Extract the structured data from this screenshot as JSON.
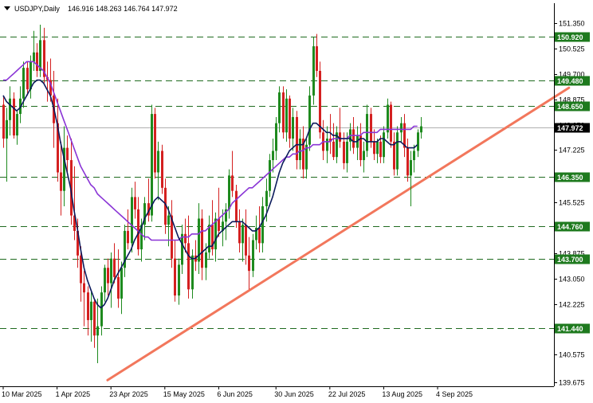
{
  "header": {
    "symbol": "USDJPY,Daily",
    "ohlc": "146.916 148.263 146.764 147.972"
  },
  "colors": {
    "background": "#ffffff",
    "bull_candle": "#1e8a1e",
    "bear_candle": "#d42020",
    "ma_fast": "#0b1a5c",
    "ma_slow": "#8a35d6",
    "trendline": "#f2775c",
    "level_badge": "#1e7a1e",
    "level_line": "#1f6b1f",
    "price_badge": "#000000",
    "axis": "#000000"
  },
  "chart_data": {
    "type": "candlestick",
    "title": "USDJPY,Daily",
    "ylim": [
      139.55,
      152.0
    ],
    "y_ticks": [
      "151.350",
      "150.525",
      "149.700",
      "148.875",
      "148.050",
      "147.225",
      "146.400",
      "145.525",
      "144.700",
      "143.875",
      "143.050",
      "142.225",
      "141.400",
      "140.575",
      "139.675"
    ],
    "x_labels": [
      "10 Mar 2025",
      "1 Apr 2025",
      "23 Apr 2025",
      "15 May 2025",
      "6 Jun 2025",
      "30 Jun 2025",
      "22 Jul 2025",
      "13 Aug 2025",
      "4 Sep 2025"
    ],
    "x_label_index": [
      0,
      16,
      32,
      48,
      64,
      81,
      97,
      113,
      129
    ],
    "current_price": "147.972",
    "levels": [
      {
        "label": "150.920",
        "value": 150.92
      },
      {
        "label": "149.480",
        "value": 149.48
      },
      {
        "label": "148.650",
        "value": 148.65
      },
      {
        "label": "146.350",
        "value": 146.35
      },
      {
        "label": "144.760",
        "value": 144.76
      },
      {
        "label": "143.700",
        "value": 143.7
      },
      {
        "label": "141.440",
        "value": 141.44
      }
    ],
    "trendline": {
      "start": {
        "index": 31,
        "price": 139.75
      },
      "end": {
        "index": 168,
        "price": 149.25
      }
    },
    "candles": [
      [
        148.7,
        149.0,
        147.3,
        147.6
      ],
      [
        147.6,
        148.6,
        146.2,
        148.2
      ],
      [
        148.2,
        149.3,
        147.7,
        148.9
      ],
      [
        148.9,
        149.1,
        147.6,
        147.7
      ],
      [
        147.7,
        148.5,
        147.4,
        148.4
      ],
      [
        148.4,
        149.3,
        148.1,
        148.9
      ],
      [
        148.9,
        150.1,
        148.6,
        149.9
      ],
      [
        149.9,
        150.1,
        149.0,
        149.2
      ],
      [
        149.2,
        150.3,
        148.9,
        150.1
      ],
      [
        150.1,
        151.1,
        149.8,
        150.4
      ],
      [
        150.4,
        150.7,
        149.6,
        149.8
      ],
      [
        149.8,
        151.3,
        149.6,
        150.8
      ],
      [
        150.8,
        151.2,
        149.4,
        149.6
      ],
      [
        149.6,
        150.1,
        148.8,
        149.5
      ],
      [
        149.5,
        150.2,
        148.8,
        149.0
      ],
      [
        149.0,
        149.8,
        147.3,
        148.1
      ],
      [
        148.1,
        148.9,
        146.2,
        146.5
      ],
      [
        146.5,
        147.5,
        145.1,
        145.9
      ],
      [
        145.9,
        148.0,
        145.4,
        147.3
      ],
      [
        147.3,
        147.7,
        146.5,
        146.9
      ],
      [
        146.9,
        147.6,
        144.8,
        145.1
      ],
      [
        145.1,
        146.7,
        144.3,
        144.6
      ],
      [
        144.6,
        145.0,
        143.4,
        143.8
      ],
      [
        143.8,
        144.1,
        142.3,
        142.9
      ],
      [
        142.9,
        143.3,
        141.5,
        142.6
      ],
      [
        142.6,
        142.8,
        141.2,
        141.7
      ],
      [
        141.7,
        142.6,
        141.0,
        142.3
      ],
      [
        142.3,
        142.4,
        140.8,
        141.2
      ],
      [
        141.2,
        142.4,
        140.3,
        141.5
      ],
      [
        141.5,
        142.8,
        141.2,
        142.6
      ],
      [
        142.6,
        143.5,
        142.3,
        143.4
      ],
      [
        143.4,
        143.7,
        142.5,
        142.9
      ],
      [
        142.9,
        143.9,
        142.1,
        143.7
      ],
      [
        143.7,
        144.2,
        142.9,
        143.1
      ],
      [
        143.1,
        144.0,
        142.1,
        142.4
      ],
      [
        142.4,
        143.6,
        141.9,
        143.4
      ],
      [
        143.4,
        144.8,
        143.1,
        144.6
      ],
      [
        144.6,
        145.3,
        144.0,
        144.2
      ],
      [
        144.2,
        146.0,
        143.9,
        145.7
      ],
      [
        145.7,
        146.2,
        145.0,
        145.3
      ],
      [
        145.3,
        145.7,
        143.8,
        144.0
      ],
      [
        144.0,
        145.0,
        143.6,
        144.8
      ],
      [
        144.8,
        145.7,
        144.3,
        145.5
      ],
      [
        145.5,
        146.3,
        144.9,
        145.1
      ],
      [
        145.1,
        148.7,
        144.9,
        148.4
      ],
      [
        148.4,
        148.6,
        146.3,
        146.5
      ],
      [
        146.5,
        147.5,
        145.6,
        147.2
      ],
      [
        147.2,
        147.4,
        145.8,
        146.0
      ],
      [
        146.0,
        146.3,
        144.5,
        144.8
      ],
      [
        144.8,
        145.4,
        144.1,
        145.1
      ],
      [
        145.1,
        145.6,
        143.4,
        143.7
      ],
      [
        143.7,
        144.3,
        142.3,
        142.5
      ],
      [
        142.5,
        143.7,
        142.2,
        143.5
      ],
      [
        143.5,
        144.8,
        143.2,
        144.5
      ],
      [
        144.5,
        145.0,
        143.9,
        144.2
      ],
      [
        144.2,
        145.1,
        142.4,
        142.7
      ],
      [
        142.7,
        144.0,
        142.4,
        143.8
      ],
      [
        143.8,
        144.3,
        143.3,
        143.6
      ],
      [
        143.6,
        145.5,
        143.2,
        145.0
      ],
      [
        145.0,
        145.3,
        143.0,
        143.4
      ],
      [
        143.4,
        144.2,
        143.0,
        143.9
      ],
      [
        143.9,
        145.1,
        143.7,
        144.8
      ],
      [
        144.8,
        145.6,
        143.8,
        144.0
      ],
      [
        144.0,
        145.2,
        143.6,
        145.0
      ],
      [
        145.0,
        146.0,
        144.4,
        144.6
      ],
      [
        144.6,
        145.3,
        144.1,
        144.9
      ],
      [
        144.9,
        145.5,
        144.3,
        145.3
      ],
      [
        145.3,
        146.6,
        145.0,
        146.4
      ],
      [
        146.4,
        147.2,
        145.7,
        145.9
      ],
      [
        145.9,
        146.1,
        144.7,
        144.9
      ],
      [
        144.9,
        145.3,
        143.9,
        144.2
      ],
      [
        144.2,
        145.0,
        143.6,
        144.8
      ],
      [
        144.8,
        145.3,
        143.5,
        143.8
      ],
      [
        143.8,
        144.4,
        142.7,
        143.3
      ],
      [
        143.3,
        144.5,
        143.1,
        144.3
      ],
      [
        144.3,
        145.1,
        144.0,
        144.7
      ],
      [
        144.7,
        145.4,
        143.9,
        144.2
      ],
      [
        144.2,
        145.7,
        143.9,
        145.4
      ],
      [
        145.4,
        146.3,
        144.9,
        145.9
      ],
      [
        145.9,
        147.1,
        145.7,
        146.9
      ],
      [
        146.9,
        147.6,
        146.5,
        147.2
      ],
      [
        147.2,
        148.3,
        146.9,
        148.1
      ],
      [
        148.1,
        149.3,
        147.8,
        149.1
      ],
      [
        149.1,
        149.3,
        147.6,
        147.8
      ],
      [
        147.8,
        149.2,
        147.5,
        148.9
      ],
      [
        148.9,
        149.0,
        147.3,
        147.6
      ],
      [
        147.6,
        148.6,
        147.2,
        148.3
      ],
      [
        148.3,
        148.5,
        146.6,
        146.9
      ],
      [
        146.9,
        147.9,
        146.6,
        147.6
      ],
      [
        147.6,
        148.0,
        146.3,
        146.6
      ],
      [
        146.6,
        147.6,
        146.3,
        147.4
      ],
      [
        147.4,
        149.3,
        147.2,
        149.0
      ],
      [
        149.0,
        150.9,
        148.7,
        150.6
      ],
      [
        150.6,
        151.0,
        149.6,
        149.8
      ],
      [
        149.8,
        150.1,
        147.6,
        147.8
      ],
      [
        147.8,
        148.2,
        146.9,
        147.2
      ],
      [
        147.2,
        148.0,
        146.8,
        147.6
      ],
      [
        147.6,
        148.4,
        147.1,
        147.5
      ],
      [
        147.5,
        148.1,
        146.9,
        147.0
      ],
      [
        147.0,
        148.0,
        146.8,
        147.8
      ],
      [
        147.8,
        148.6,
        147.3,
        147.5
      ],
      [
        147.5,
        147.8,
        146.6,
        146.8
      ],
      [
        146.8,
        147.8,
        146.5,
        147.5
      ],
      [
        147.5,
        148.1,
        147.2,
        147.9
      ],
      [
        147.9,
        148.3,
        147.1,
        147.3
      ],
      [
        147.3,
        148.0,
        146.9,
        147.7
      ],
      [
        147.7,
        148.1,
        146.7,
        146.9
      ],
      [
        146.9,
        147.5,
        146.5,
        147.2
      ],
      [
        147.2,
        148.7,
        147.0,
        148.4
      ],
      [
        148.4,
        148.6,
        147.3,
        147.5
      ],
      [
        147.5,
        147.9,
        146.9,
        147.1
      ],
      [
        147.1,
        147.6,
        146.8,
        147.5
      ],
      [
        147.5,
        147.7,
        146.8,
        147.0
      ],
      [
        147.0,
        148.0,
        146.8,
        147.8
      ],
      [
        147.8,
        148.9,
        147.6,
        148.7
      ],
      [
        148.7,
        148.8,
        147.3,
        147.5
      ],
      [
        147.5,
        147.8,
        146.4,
        146.6
      ],
      [
        146.6,
        148.0,
        146.4,
        147.8
      ],
      [
        147.8,
        148.3,
        147.5,
        148.1
      ],
      [
        148.1,
        148.4,
        147.0,
        147.3
      ],
      [
        147.3,
        147.6,
        146.2,
        146.4
      ],
      [
        146.4,
        147.2,
        145.4,
        146.9
      ],
      [
        146.9,
        147.4,
        146.5,
        147.2
      ],
      [
        147.2,
        147.9,
        147.0,
        147.8
      ],
      [
        147.8,
        148.3,
        147.6,
        148.0
      ]
    ],
    "ma_fast": {
      "start_index": 0,
      "values": [
        149.0,
        148.8,
        148.7,
        148.6,
        148.5,
        148.6,
        148.8,
        149.0,
        149.2,
        149.4,
        149.5,
        149.5,
        149.4,
        149.2,
        149.0,
        148.6,
        148.1,
        147.5,
        147.0,
        146.5,
        146.0,
        145.3,
        144.7,
        144.0,
        143.4,
        143.0,
        142.7,
        142.4,
        142.2,
        142.1,
        142.2,
        142.4,
        142.7,
        143.0,
        143.2,
        143.4,
        143.6,
        143.8,
        144.0,
        144.3,
        144.5,
        144.7,
        145.0,
        145.2,
        145.4,
        145.6,
        145.7,
        145.6,
        145.5,
        145.3,
        145.0,
        144.7,
        144.4,
        144.2,
        144.0,
        143.8,
        143.7,
        143.7,
        143.8,
        143.9,
        144.0,
        144.1,
        144.1,
        144.3,
        144.5,
        144.6,
        144.7,
        144.8,
        144.9,
        144.9,
        144.9,
        144.9,
        144.8,
        144.7,
        144.6,
        144.6,
        144.7,
        144.9,
        145.1,
        145.4,
        145.7,
        146.1,
        146.5,
        146.8,
        147.0,
        147.2,
        147.3,
        147.4,
        147.4,
        147.4,
        147.6,
        147.9,
        148.1,
        148.1,
        148.0,
        147.9,
        147.8,
        147.8,
        147.7,
        147.7,
        147.6,
        147.6,
        147.6,
        147.6,
        147.5,
        147.5,
        147.6,
        147.6,
        147.5,
        147.5,
        147.5,
        147.5,
        147.6,
        147.6,
        147.5,
        147.4,
        147.4,
        147.5,
        147.5,
        147.4,
        147.3,
        147.3,
        147.3,
        147.4
      ]
    },
    "ma_slow": {
      "start_index": 0,
      "values": [
        149.5,
        149.5,
        149.6,
        149.7,
        149.8,
        149.9,
        150.0,
        150.1,
        150.1,
        150.1,
        150.0,
        149.9,
        149.8,
        149.6,
        149.4,
        149.1,
        148.8,
        148.5,
        148.2,
        147.9,
        147.6,
        147.3,
        147.0,
        146.7,
        146.5,
        146.3,
        146.1,
        146.0,
        145.8,
        145.7,
        145.6,
        145.5,
        145.4,
        145.3,
        145.2,
        145.1,
        145.0,
        144.9,
        144.8,
        144.7,
        144.6,
        144.5,
        144.4,
        144.4,
        144.3,
        144.3,
        144.3,
        144.3,
        144.3,
        144.3,
        144.3,
        144.3,
        144.3,
        144.4,
        144.4,
        144.4,
        144.5,
        144.5,
        144.5,
        144.6,
        144.6,
        144.7,
        144.8,
        144.9,
        145.0,
        145.1,
        145.2,
        145.3,
        145.5,
        145.6,
        145.7,
        145.8,
        145.9,
        146.0,
        146.0,
        146.1,
        146.2,
        146.3,
        146.4,
        146.5,
        146.6,
        146.7,
        146.8,
        146.9,
        147.0,
        147.0,
        147.1,
        147.1,
        147.2,
        147.2,
        147.3,
        147.3,
        147.4,
        147.4,
        147.4,
        147.5,
        147.5,
        147.5,
        147.6,
        147.6,
        147.6,
        147.6,
        147.6,
        147.7,
        147.7,
        147.7,
        147.7,
        147.8,
        147.8,
        147.8,
        147.8,
        147.8,
        147.9,
        147.9,
        147.9,
        147.9,
        147.9,
        147.9,
        147.9,
        147.9,
        147.9,
        147.9,
        148.0,
        148.0
      ]
    }
  }
}
